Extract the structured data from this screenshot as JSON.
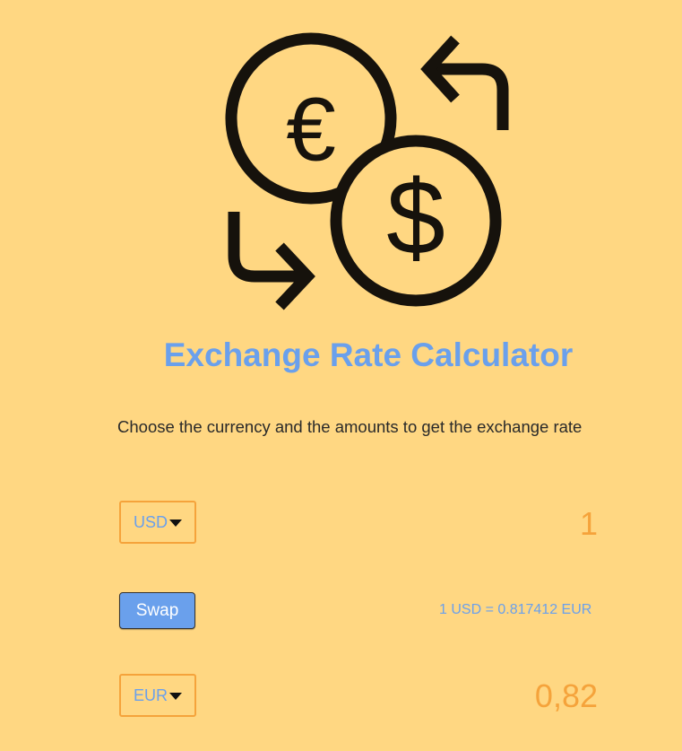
{
  "header": {
    "logo_icon": "currency-exchange-icon",
    "title": "Exchange Rate Calculator",
    "subtitle": "Choose the currency and the amounts to get the exchange rate"
  },
  "currency_one": {
    "selected": "USD",
    "amount": "1"
  },
  "swap": {
    "label": "Swap",
    "rate_text": "1 USD = 0.817412 EUR"
  },
  "currency_two": {
    "selected": "EUR",
    "amount": "0,82"
  },
  "colors": {
    "background": "#ffd782",
    "accent_blue": "#6aa0ec",
    "accent_orange": "#f5a33b",
    "text": "#2a2a2a"
  }
}
